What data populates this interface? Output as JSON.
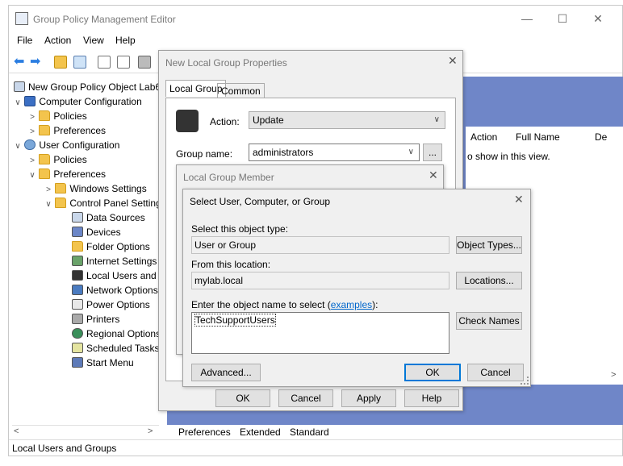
{
  "app": {
    "title": "Group Policy Management Editor",
    "menu": [
      "File",
      "Action",
      "View",
      "Help"
    ],
    "window_controls": {
      "minimize": "—",
      "maximize": "☐",
      "close": "✕"
    }
  },
  "tree": {
    "items": [
      {
        "label": "New Group Policy Object Lab6 [",
        "icon": "policy-icon",
        "chevron": ""
      },
      {
        "label": "Computer Configuration",
        "icon": "computer-icon",
        "chevron": "∨"
      },
      {
        "label": "Policies",
        "icon": "folder-icon",
        "chevron": ">"
      },
      {
        "label": "Preferences",
        "icon": "folder-icon",
        "chevron": ">"
      },
      {
        "label": "User Configuration",
        "icon": "user-icon",
        "chevron": "∨"
      },
      {
        "label": "Policies",
        "icon": "folder-icon",
        "chevron": ">"
      },
      {
        "label": "Preferences",
        "icon": "folder-icon",
        "chevron": "∨"
      },
      {
        "label": "Windows Settings",
        "icon": "folder-icon",
        "chevron": ">"
      },
      {
        "label": "Control Panel Setting",
        "icon": "control-panel-icon",
        "chevron": "∨"
      },
      {
        "label": "Data Sources",
        "icon": "data-sources-icon",
        "chevron": ""
      },
      {
        "label": "Devices",
        "icon": "devices-icon",
        "chevron": ""
      },
      {
        "label": "Folder Options",
        "icon": "folder-options-icon",
        "chevron": ""
      },
      {
        "label": "Internet Settings",
        "icon": "internet-settings-icon",
        "chevron": ""
      },
      {
        "label": "Local Users and G",
        "icon": "local-users-icon",
        "chevron": ""
      },
      {
        "label": "Network Options",
        "icon": "network-options-icon",
        "chevron": ""
      },
      {
        "label": "Power Options",
        "icon": "power-options-icon",
        "chevron": ""
      },
      {
        "label": "Printers",
        "icon": "printers-icon",
        "chevron": ""
      },
      {
        "label": "Regional Options",
        "icon": "regional-options-icon",
        "chevron": ""
      },
      {
        "label": "Scheduled Tasks",
        "icon": "scheduled-tasks-icon",
        "chevron": ""
      },
      {
        "label": "Start Menu",
        "icon": "start-menu-icon",
        "chevron": ""
      }
    ]
  },
  "right_pane": {
    "columns": [
      "Action",
      "Full Name",
      "De"
    ],
    "empty_text": "o show in this view.",
    "tabs": [
      "Preferences",
      "Extended",
      "Standard"
    ]
  },
  "status": {
    "text": "Local Users and Groups"
  },
  "nlgp": {
    "title": "New Local Group Properties",
    "tabs": [
      "Local Group",
      "Common"
    ],
    "action_label": "Action:",
    "action_value": "Update",
    "group_name_label": "Group name:",
    "group_name_value": "administrators",
    "browse_label": "...",
    "ok": "OK",
    "cancel": "Cancel",
    "apply": "Apply",
    "help": "Help"
  },
  "lgm": {
    "title": "Local Group Member"
  },
  "sel": {
    "title": "Select User, Computer, or Group",
    "object_type_label": "Select this object type:",
    "object_type_value": "User or Group",
    "object_types_btn": "Object Types...",
    "location_label": "From this location:",
    "location_value": "mylab.local",
    "locations_btn": "Locations...",
    "enter_label": "Enter the object name to select (",
    "examples_link": "examples",
    "enter_label_end": "):",
    "object_name_value": "TechSupportUsers",
    "check_names_btn": "Check Names",
    "advanced_btn": "Advanced...",
    "ok_btn": "OK",
    "cancel_btn": "Cancel"
  },
  "colors": {
    "pane_blue": "#6f86c8",
    "link": "#0066cc",
    "default_button_border": "#0078d7"
  }
}
